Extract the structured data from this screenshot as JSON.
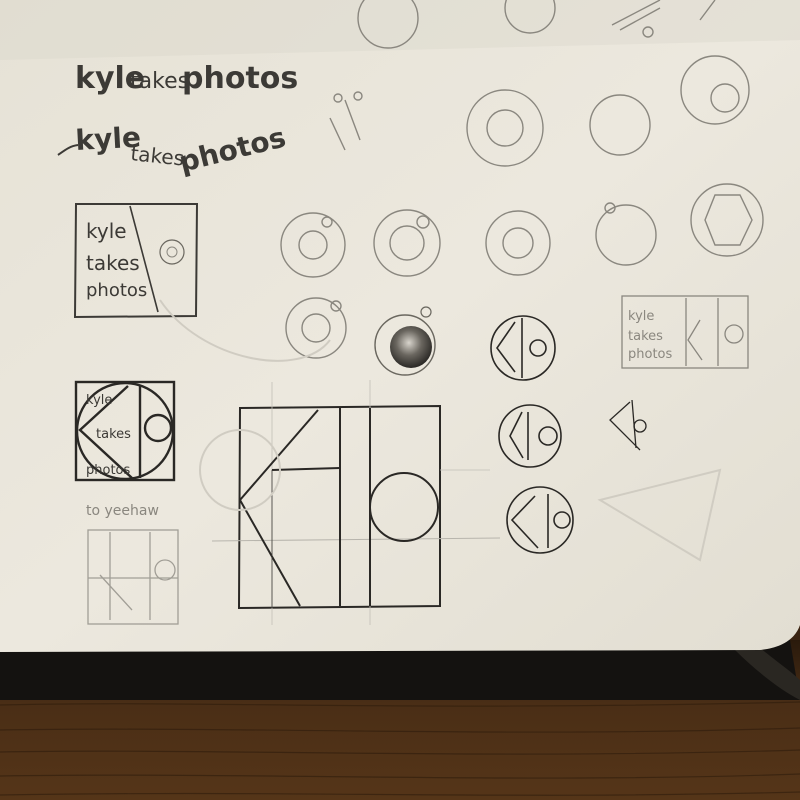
{
  "wordmarks": {
    "line1": {
      "kyle": "kyle",
      "takes": "takes",
      "photos": "photos"
    },
    "line2": {
      "kyle": "kyle",
      "takes": "takes",
      "photos": "photos"
    }
  },
  "stacked_logo": {
    "line1": "kyle",
    "line2": "takes",
    "line3": "photos"
  },
  "circle_logo": {
    "line1": "kyle",
    "line2": "takes",
    "line3": "photos"
  },
  "small_stacked_logo": {
    "line1": "kyle",
    "line2": "takes",
    "line3": "photos"
  },
  "note": "to yeehaw",
  "colors": {
    "paper": "#ece8de",
    "pencil": "#3c3a36",
    "cover": "#141210",
    "desk": "#4a2e16"
  }
}
